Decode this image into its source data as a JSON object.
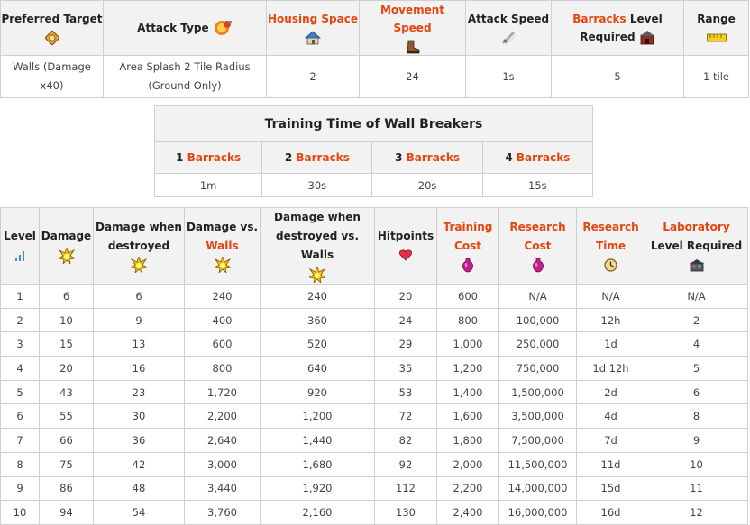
{
  "summary": {
    "headers": {
      "preferred_target": "Preferred Target",
      "attack_type": "Attack Type",
      "housing_space": "Housing Space",
      "movement_speed": "Movement Speed",
      "attack_speed": "Attack Speed",
      "barracks": "Barracks",
      "level_required": "Level Required",
      "range": "Range"
    },
    "values": {
      "preferred_target": "Walls (Damage x40)",
      "attack_type": "Area Splash 2 Tile Radius (Ground Only)",
      "housing_space": "2",
      "movement_speed": "24",
      "attack_speed": "1s",
      "barracks_level": "5",
      "range": "1 tile"
    }
  },
  "training": {
    "title": "Training Time of Wall Breakers",
    "barracks_word": "Barracks",
    "columns": [
      {
        "count": "1",
        "time": "1m"
      },
      {
        "count": "2",
        "time": "30s"
      },
      {
        "count": "3",
        "time": "20s"
      },
      {
        "count": "4",
        "time": "15s"
      }
    ]
  },
  "levels": {
    "headers": {
      "level": "Level",
      "damage": "Damage",
      "damage_when_destroyed": "Damage when destroyed",
      "damage_vs": "Damage vs.",
      "walls": "Walls",
      "damage_destroyed_walls": "Damage when destroyed vs. Walls",
      "hitpoints": "Hitpoints",
      "training_cost": "Training Cost",
      "research_cost": "Research Cost",
      "research_time": "Research Time",
      "laboratory": "Laboratory",
      "level_required": "Level Required"
    },
    "rows": [
      [
        "1",
        "6",
        "6",
        "240",
        "240",
        "20",
        "600",
        "N/A",
        "N/A",
        "N/A"
      ],
      [
        "2",
        "10",
        "9",
        "400",
        "360",
        "24",
        "800",
        "100,000",
        "12h",
        "2"
      ],
      [
        "3",
        "15",
        "13",
        "600",
        "520",
        "29",
        "1,000",
        "250,000",
        "1d",
        "4"
      ],
      [
        "4",
        "20",
        "16",
        "800",
        "640",
        "35",
        "1,200",
        "750,000",
        "1d 12h",
        "5"
      ],
      [
        "5",
        "43",
        "23",
        "1,720",
        "920",
        "53",
        "1,400",
        "1,500,000",
        "2d",
        "6"
      ],
      [
        "6",
        "55",
        "30",
        "2,200",
        "1,200",
        "72",
        "1,600",
        "3,500,000",
        "4d",
        "8"
      ],
      [
        "7",
        "66",
        "36",
        "2,640",
        "1,440",
        "82",
        "1,800",
        "7,500,000",
        "7d",
        "9"
      ],
      [
        "8",
        "75",
        "42",
        "3,000",
        "1,680",
        "92",
        "2,000",
        "11,500,000",
        "11d",
        "10"
      ],
      [
        "9",
        "86",
        "48",
        "3,440",
        "1,920",
        "112",
        "2,200",
        "14,000,000",
        "15d",
        "11"
      ],
      [
        "10",
        "94",
        "54",
        "3,760",
        "2,160",
        "130",
        "2,400",
        "16,000,000",
        "16d",
        "12"
      ]
    ]
  }
}
